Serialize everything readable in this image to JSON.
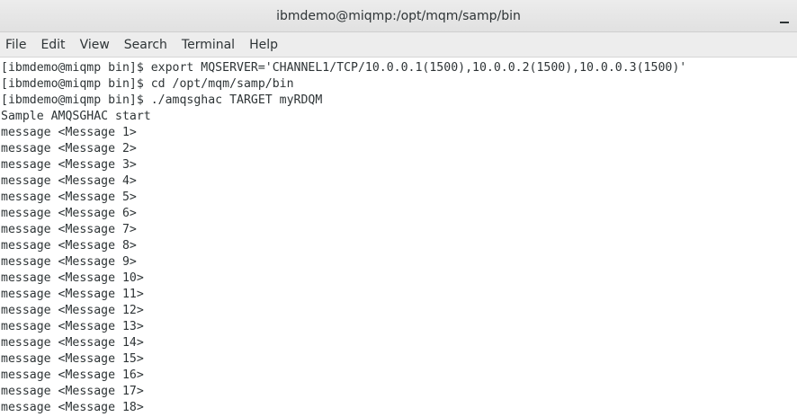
{
  "window": {
    "title": "ibmdemo@miqmp:/opt/mqm/samp/bin"
  },
  "menu": [
    {
      "label": "File"
    },
    {
      "label": "Edit"
    },
    {
      "label": "View"
    },
    {
      "label": "Search"
    },
    {
      "label": "Terminal"
    },
    {
      "label": "Help"
    }
  ],
  "terminal": {
    "lines": [
      "[ibmdemo@miqmp bin]$ export MQSERVER='CHANNEL1/TCP/10.0.0.1(1500),10.0.0.2(1500),10.0.0.3(1500)'",
      "[ibmdemo@miqmp bin]$ cd /opt/mqm/samp/bin",
      "[ibmdemo@miqmp bin]$ ./amqsghac TARGET myRDQM",
      "Sample AMQSGHAC start",
      "message <Message 1>",
      "message <Message 2>",
      "message <Message 3>",
      "message <Message 4>",
      "message <Message 5>",
      "message <Message 6>",
      "message <Message 7>",
      "message <Message 8>",
      "message <Message 9>",
      "message <Message 10>",
      "message <Message 11>",
      "message <Message 12>",
      "message <Message 13>",
      "message <Message 14>",
      "message <Message 15>",
      "message <Message 16>",
      "message <Message 17>",
      "message <Message 18>"
    ]
  }
}
